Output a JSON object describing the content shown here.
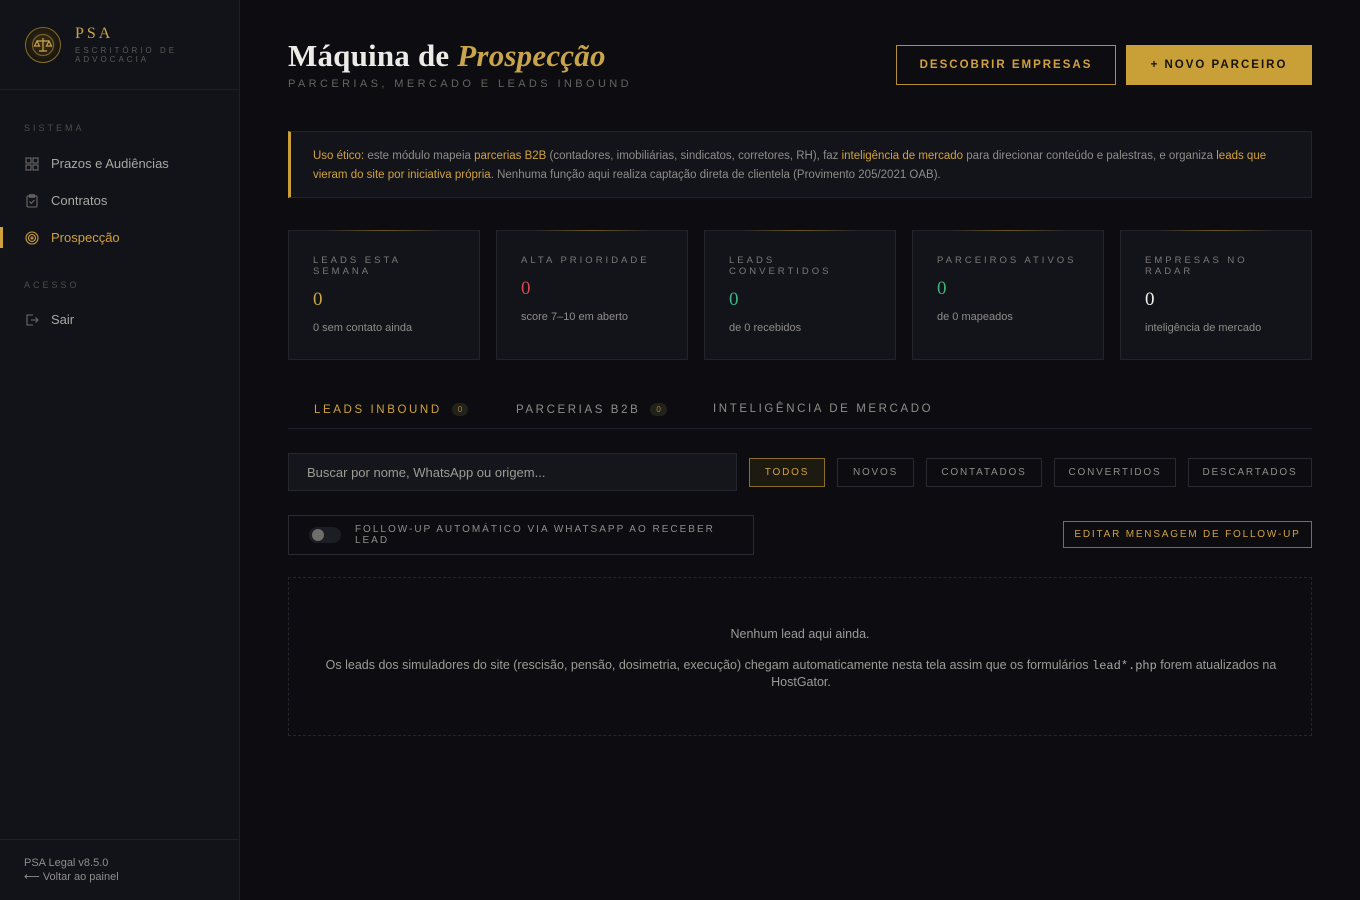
{
  "brand": {
    "name": "PSA",
    "subtitle": "ESCRITÓRIO DE ADVOCACIA"
  },
  "sidebar": {
    "section_sistema": "SISTEMA",
    "items": [
      {
        "label": "Prazos e Audiências",
        "icon": "grid-icon"
      },
      {
        "label": "Contratos",
        "icon": "clipboard-icon"
      },
      {
        "label": "Prospecção",
        "icon": "target-icon",
        "active": true
      }
    ],
    "section_acesso": "ACESSO",
    "logout": {
      "label": "Sair",
      "icon": "logout-icon"
    },
    "footer": {
      "version": "PSA Legal v8.5.0",
      "back": "⟵ Voltar ao painel"
    }
  },
  "header": {
    "title_prefix": "Máquina de ",
    "title_accent": "Prospecção",
    "subtitle": "PARCERIAS, MERCADO E LEADS INBOUND",
    "btn_discover": "DESCOBRIR EMPRESAS",
    "btn_new_partner": "+ NOVO PARCEIRO"
  },
  "notice": {
    "lead": "Uso ético:",
    "t1": " este módulo mapeia ",
    "h1": "parcerias B2B",
    "t2": " (contadores, imobiliárias, sindicatos, corretores, RH), faz ",
    "h2": "inteligência de mercado",
    "t3": " para direcionar conteúdo e palestras, e organiza ",
    "h3": "leads que vieram do site por iniciativa própria",
    "t4": ". Nenhuma função aqui realiza captação direta de clientela (Provimento 205/2021 OAB)."
  },
  "cards": [
    {
      "label": "LEADS ESTA SEMANA",
      "value": "0",
      "desc": "0 sem contato ainda",
      "color": "#c9a44a"
    },
    {
      "label": "ALTA PRIORIDADE",
      "value": "0",
      "desc": "score 7–10 em aberto",
      "color": "#d6474f"
    },
    {
      "label": "LEADS CONVERTIDOS",
      "value": "0",
      "desc": "de 0 recebidos",
      "color": "#3fb37f"
    },
    {
      "label": "PARCEIROS ATIVOS",
      "value": "0",
      "desc": "de 0 mapeados",
      "color": "#3fb37f"
    },
    {
      "label": "EMPRESAS NO RADAR",
      "value": "0",
      "desc": "inteligência de mercado",
      "color": "#f0efea"
    }
  ],
  "tabs": [
    {
      "label": "LEADS INBOUND",
      "count": "0",
      "active": true
    },
    {
      "label": "PARCERIAS B2B",
      "count": "0"
    },
    {
      "label": "INTELIGÊNCIA DE MERCADO"
    }
  ],
  "search": {
    "placeholder": "Buscar por nome, WhatsApp ou origem..."
  },
  "filters": [
    "TODOS",
    "NOVOS",
    "CONTATADOS",
    "CONVERTIDOS",
    "DESCARTADOS"
  ],
  "followup": {
    "toggle_label": "FOLLOW-UP AUTOMÁTICO VIA WHATSAPP AO RECEBER LEAD",
    "enabled": false,
    "edit_button": "EDITAR MENSAGEM DE FOLLOW-UP"
  },
  "empty": {
    "title": "Nenhum lead aqui ainda.",
    "desc_before": "Os leads dos simuladores do site (rescisão, pensão, dosimetria, execução) chegam automaticamente nesta tela assim que os formulários ",
    "code": "lead*.php",
    "desc_after": " forem atualizados na HostGator."
  }
}
